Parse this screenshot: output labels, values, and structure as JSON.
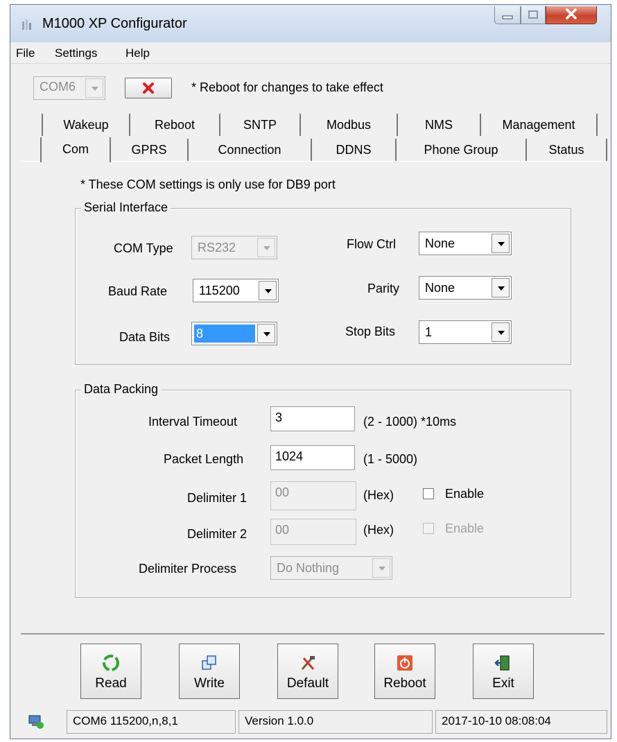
{
  "window": {
    "title": "M1000 XP Configurator"
  },
  "menu": {
    "items": [
      "File",
      "Settings",
      "Help"
    ]
  },
  "toolbar": {
    "port_value": "COM6",
    "reboot_note": "* Reboot for changes to take effect"
  },
  "tabs": {
    "row1": [
      "Wakeup",
      "Reboot",
      "SNTP",
      "Modbus",
      "NMS",
      "Management"
    ],
    "row2": [
      "Com",
      "GPRS",
      "Connection",
      "DDNS",
      "Phone Group",
      "Status"
    ],
    "active": "Com"
  },
  "com_tab": {
    "note": "* These COM settings is only use for DB9 port",
    "serial_interface": {
      "title": "Serial Interface",
      "com_type": {
        "label": "COM Type",
        "value": "RS232"
      },
      "baud_rate": {
        "label": "Baud Rate",
        "value": "115200"
      },
      "data_bits": {
        "label": "Data Bits",
        "value": "8"
      },
      "flow_ctrl": {
        "label": "Flow Ctrl",
        "value": "None"
      },
      "parity": {
        "label": "Parity",
        "value": "None"
      },
      "stop_bits": {
        "label": "Stop Bits",
        "value": "1"
      }
    },
    "data_packing": {
      "title": "Data Packing",
      "interval_timeout": {
        "label": "Interval Timeout",
        "value": "3",
        "hint": "(2 - 1000) *10ms"
      },
      "packet_length": {
        "label": "Packet Length",
        "value": "1024",
        "hint": "(1 - 5000)"
      },
      "delimiter1": {
        "label": "Delimiter 1",
        "value": "00",
        "hint": "(Hex)",
        "enable_label": "Enable",
        "enabled": false
      },
      "delimiter2": {
        "label": "Delimiter 2",
        "value": "00",
        "hint": "(Hex)",
        "enable_label": "Enable",
        "enabled": false
      },
      "delimiter_process": {
        "label": "Delimiter Process",
        "value": "Do Nothing"
      }
    }
  },
  "buttons": {
    "read": "Read",
    "write": "Write",
    "default": "Default",
    "reboot": "Reboot",
    "exit": "Exit"
  },
  "statusbar": {
    "connection": "COM6 115200,n,8,1",
    "version": "Version 1.0.0",
    "datetime": "2017-10-10 08:08:04"
  },
  "colors": {
    "selection": "#3399ff",
    "close_button": "#c8442d",
    "window_bg": "#f0f0f0"
  }
}
